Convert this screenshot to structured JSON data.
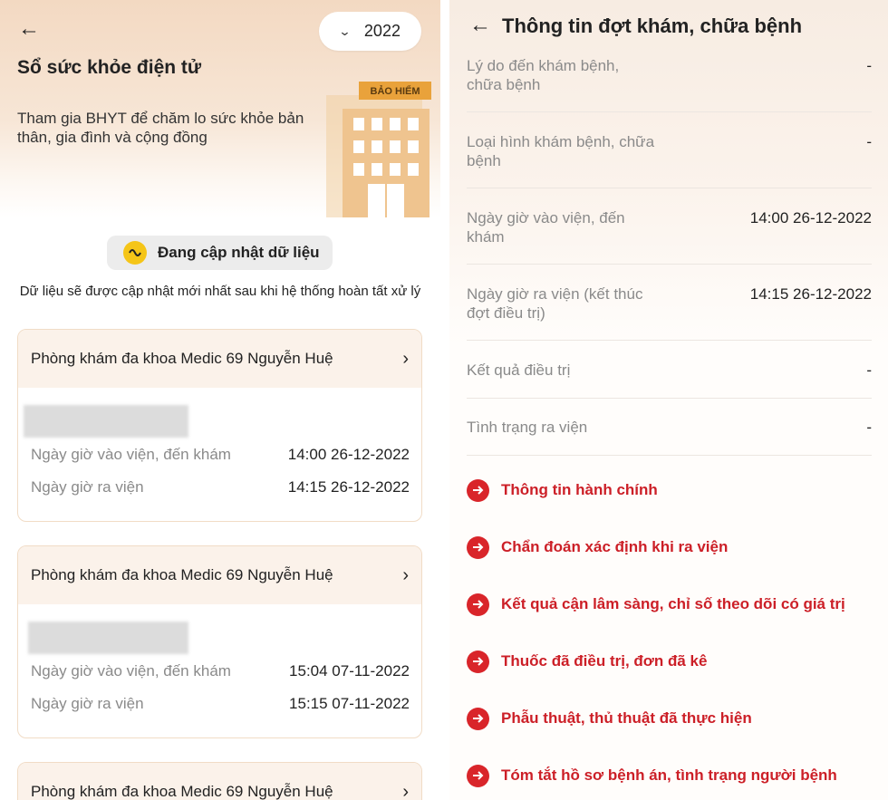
{
  "left": {
    "year": "2022",
    "title": "Sổ sức khỏe điện tử",
    "subtitle": "Tham gia BHYT để chăm lo sức khỏe bản thân, gia đình và cộng đồng",
    "building_sign": "BẢO HIỂM",
    "update_label": "Đang cập nhật dữ liệu",
    "update_note": "Dữ liệu sẽ được cập nhật mới nhất sau khi hệ thống hoàn tất xử lý",
    "visits": [
      {
        "clinic": "Phòng khám đa khoa Medic 69 Nguyễn Huệ",
        "checkin_label": "Ngày giờ vào viện, đến khám",
        "checkin_value": "14:00 26-12-2022",
        "checkout_label": "Ngày giờ ra viện",
        "checkout_value": "14:15 26-12-2022"
      },
      {
        "clinic": "Phòng khám đa khoa Medic 69 Nguyễn Huệ",
        "checkin_label": "Ngày giờ vào viện, đến khám",
        "checkin_value": "15:04 07-11-2022",
        "checkout_label": "Ngày giờ ra viện",
        "checkout_value": "15:15 07-11-2022"
      },
      {
        "clinic": "Phòng khám đa khoa Medic 69 Nguyễn Huệ"
      }
    ]
  },
  "right": {
    "title": "Thông tin đợt khám, chữa bệnh",
    "rows": [
      {
        "label": "Lý do đến khám bệnh, chữa bệnh",
        "value": "-"
      },
      {
        "label": "Loại hình khám bệnh, chữa bệnh",
        "value": "-"
      },
      {
        "label": "Ngày giờ vào viện, đến khám",
        "value": "14:00 26-12-2022"
      },
      {
        "label": "Ngày giờ ra viện (kết thúc đợt điều trị)",
        "value": "14:15 26-12-2022"
      },
      {
        "label": "Kết quả điều trị",
        "value": "-"
      },
      {
        "label": "Tình trạng ra viện",
        "value": "-"
      }
    ],
    "links": [
      "Thông tin hành chính",
      "Chẩn đoán xác định khi ra viện",
      "Kết quả cận lâm sàng, chỉ số theo dõi có giá trị",
      "Thuốc đã điều trị, đơn đã kê",
      "Phẫu thuật, thủ thuật đã thực hiện",
      "Tóm tắt hồ sơ bệnh án, tình trạng người bệnh"
    ]
  },
  "colors": {
    "accent_red": "#cc1f27",
    "hero_peach": "#f3d9c2",
    "update_yellow": "#f5c518"
  }
}
